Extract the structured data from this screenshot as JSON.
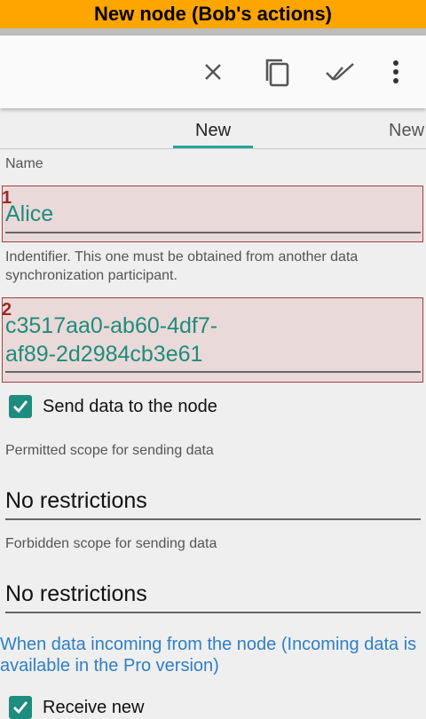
{
  "banner": {
    "title": "New node (Bob's actions)"
  },
  "toolbar": {
    "icons": [
      "close-icon",
      "copy-icon",
      "done-all-icon",
      "more-vert-icon"
    ],
    "color": "#555555"
  },
  "tabs": [
    {
      "label": "New"
    },
    {
      "label": "New"
    }
  ],
  "form": {
    "name_label": "Name",
    "name_marker": "1",
    "name_value": "Alice",
    "identifier_label": "Indentifier. This one must be obtained from another data synchronization participant.",
    "identifier_marker": "2",
    "identifier_line1": "c3517aa0-ab60-4df7-",
    "identifier_line2": "af89-2d2984cb3e61",
    "send_checkbox_label": "Send data to the node",
    "send_checked": true,
    "permitted_label": "Permitted scope for sending data",
    "permitted_value": "No restrictions",
    "forbidden_label": "Forbidden scope for sending data",
    "forbidden_value": "No restrictions",
    "incoming_note": "When data incoming from the node (Incoming data is available in the Pro version)",
    "receive_checkbox_label": "Receive new",
    "receive_checked": true
  },
  "colors": {
    "accent": "#1e8c7e",
    "banner": "#ffa500",
    "link": "#2f7fc6",
    "highlight_border": "#a04040"
  }
}
